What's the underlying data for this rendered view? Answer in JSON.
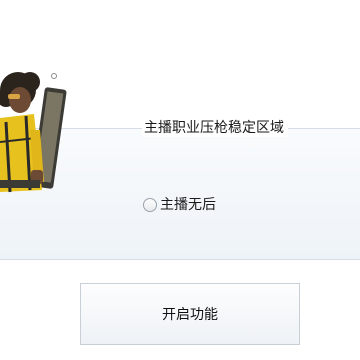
{
  "group": {
    "title": "主播职业压枪稳定区域"
  },
  "radio": {
    "label": "主播无后",
    "checked": false
  },
  "button": {
    "label": "开启功能"
  },
  "colors": {
    "accent_yellow": "#e7c21e",
    "group_border": "#d6dde6",
    "button_border": "#c9cfd6"
  },
  "icons": {
    "character": "streamer-character-illustration"
  }
}
